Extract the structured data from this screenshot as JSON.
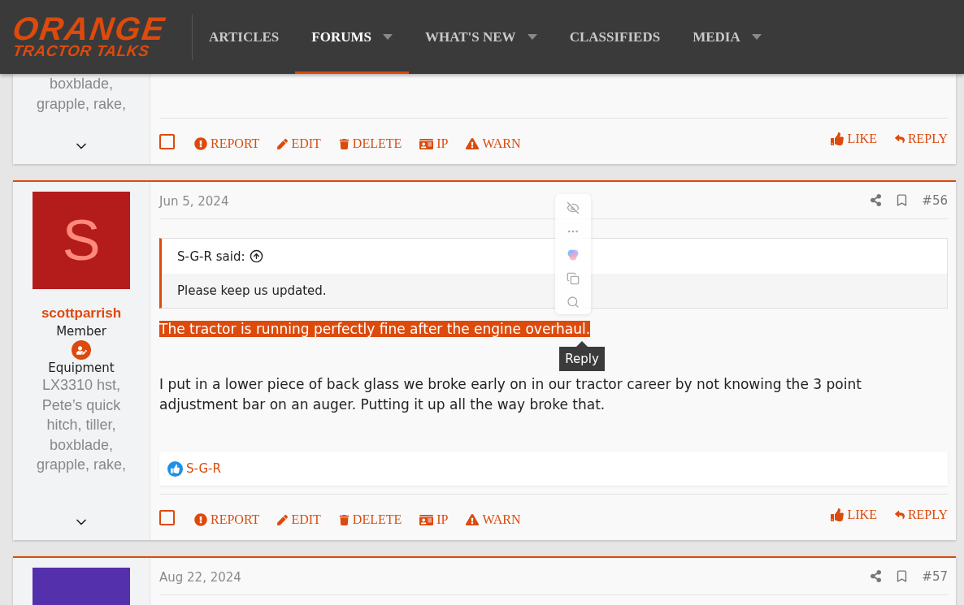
{
  "header": {
    "logo": {
      "line_1": "ORANGE",
      "line_2": "TRACTOR TALKS"
    },
    "nav": [
      {
        "label": "ARTICLES",
        "selected": false,
        "has_menu": false
      },
      {
        "label": "FORUMS",
        "selected": true,
        "has_menu": true
      },
      {
        "label": "WHAT'S NEW",
        "selected": false,
        "has_menu": true
      },
      {
        "label": "CLASSIFIEDS",
        "selected": false,
        "has_menu": false
      },
      {
        "label": "MEDIA",
        "selected": false,
        "has_menu": true
      }
    ]
  },
  "posts": [
    {
      "kind": "tail",
      "user": {
        "equipment": "boxblade, grapple, rake,"
      },
      "select_checked": false,
      "actions": [
        {
          "kind": "report",
          "label": "REPORT"
        },
        {
          "kind": "edit",
          "label": "EDIT"
        },
        {
          "kind": "delete",
          "label": "DELETE"
        },
        {
          "kind": "ip",
          "label": "IP"
        },
        {
          "kind": "warn",
          "label": "WARN"
        }
      ],
      "reply_actions": [
        {
          "kind": "like",
          "label": "LIKE"
        },
        {
          "kind": "reply",
          "label": "REPLY"
        }
      ]
    },
    {
      "kind": "full",
      "user": {
        "avatar_letter": "S",
        "color": "#b41c1c",
        "name": "scottparrish",
        "role": "Member",
        "equipment_label": "Equipment",
        "equipment": "LX3310 hst, Pete’s quick hitch, tiller, boxblade, grapple, rake,"
      },
      "date": "Jun 5, 2024",
      "number": "#56",
      "quote": {
        "author": "S-G-R said:",
        "text": "Please keep us updated."
      },
      "highlighted_text": "The tractor is running perfectly fine after the engine overhaul.",
      "body": "I put in a lower piece of back glass we broke early on in our tractor career by not knowing the 3 point adjustment bar on an auger. Putting it up all the way broke that.",
      "reactions": [
        "S-G-R"
      ],
      "selection_popup": {
        "tooltip": "Reply"
      },
      "select_checked": false,
      "actions": [
        {
          "kind": "report",
          "label": "REPORT"
        },
        {
          "kind": "edit",
          "label": "EDIT"
        },
        {
          "kind": "delete",
          "label": "DELETE"
        },
        {
          "kind": "ip",
          "label": "IP"
        },
        {
          "kind": "warn",
          "label": "WARN"
        }
      ],
      "reply_actions": [
        {
          "kind": "like",
          "label": "LIKE"
        },
        {
          "kind": "reply",
          "label": "REPLY"
        }
      ]
    },
    {
      "kind": "head",
      "user": {
        "color": "#5530ad"
      },
      "date": "Aug 22, 2024",
      "number": "#57"
    }
  ]
}
